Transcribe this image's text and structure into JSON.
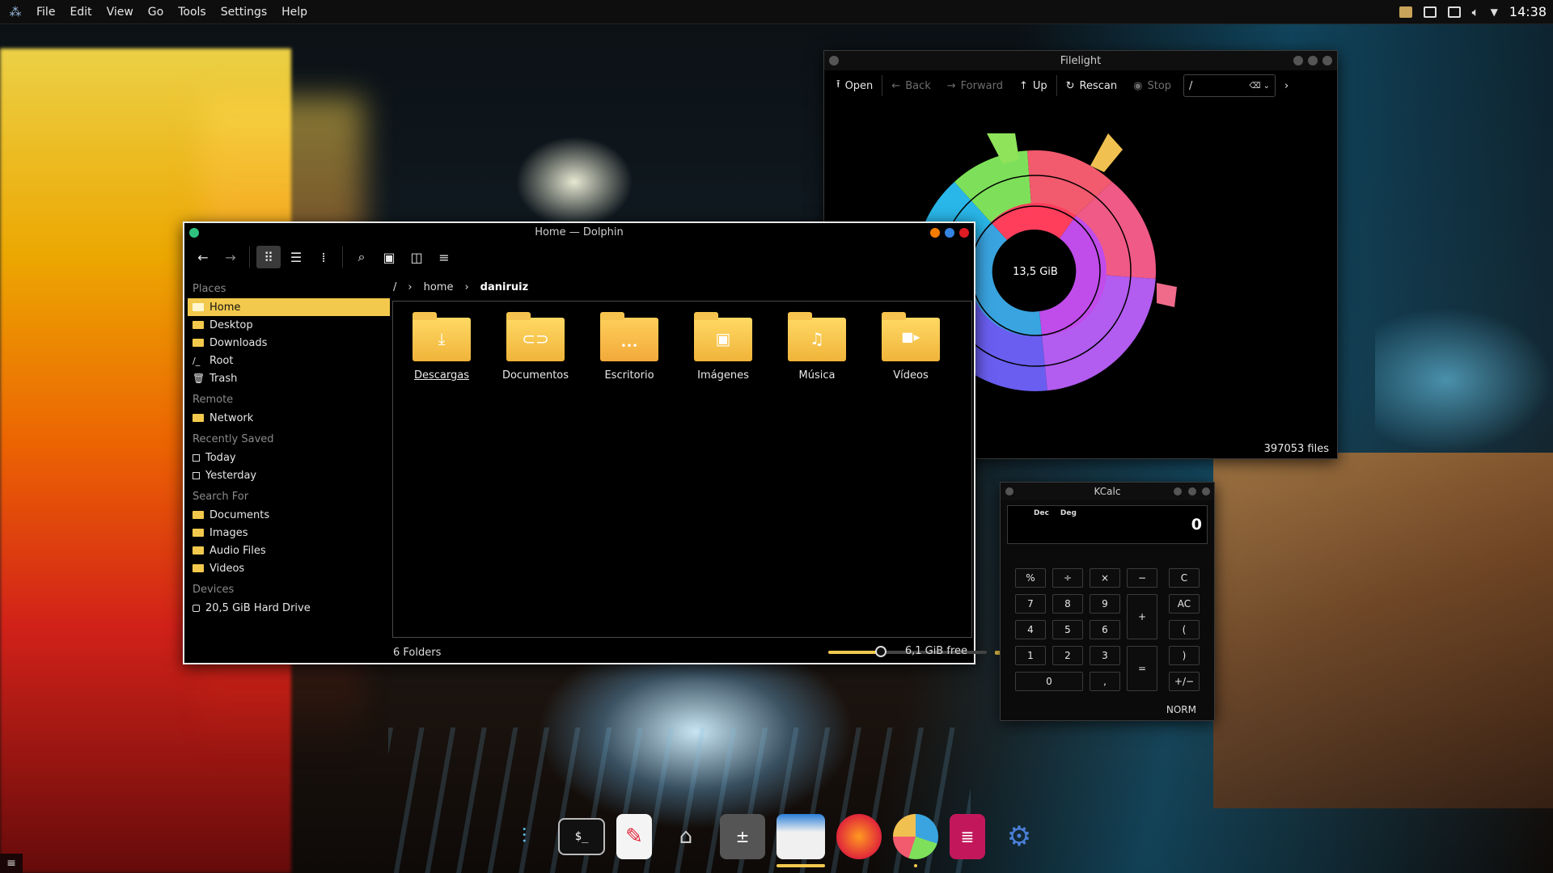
{
  "panel": {
    "menu": [
      "File",
      "Edit",
      "View",
      "Go",
      "Tools",
      "Settings",
      "Help"
    ],
    "clock": "14:38",
    "tray_icons": [
      "clipboard-icon",
      "display-icon",
      "notes-icon",
      "volume-icon",
      "arrow-down-icon"
    ]
  },
  "dolphin": {
    "title": "Home — Dolphin",
    "places": {
      "heading_places": "Places",
      "places_items": [
        "Home",
        "Desktop",
        "Downloads",
        "Root",
        "Trash"
      ],
      "heading_remote": "Remote",
      "remote_items": [
        "Network"
      ],
      "heading_recent": "Recently Saved",
      "recent_items": [
        "Today",
        "Yesterday"
      ],
      "heading_search": "Search For",
      "search_items": [
        "Documents",
        "Images",
        "Audio Files",
        "Videos"
      ],
      "heading_devices": "Devices",
      "devices_items": [
        "20,5 GiB Hard Drive"
      ]
    },
    "breadcrumb": {
      "root": "/",
      "home": "home",
      "current": "daniruiz"
    },
    "folders": [
      {
        "name": "Descargas",
        "glyph": "⤓"
      },
      {
        "name": "Documentos",
        "glyph": "⊂⊃"
      },
      {
        "name": "Escritorio",
        "glyph": "•••"
      },
      {
        "name": "Imágenes",
        "glyph": "▣"
      },
      {
        "name": "Música",
        "glyph": "♫"
      },
      {
        "name": "Vídeos",
        "glyph": "■▸"
      }
    ],
    "status": {
      "count": "6 Folders",
      "free": "6,1 GiB free",
      "zoom_fraction": 0.33,
      "used_fraction": 0.7
    },
    "accent": "#f2c94c"
  },
  "filelight": {
    "title": "Filelight",
    "toolbar": {
      "open": "Open",
      "back": "Back",
      "forward": "Forward",
      "up": "Up",
      "rescan": "Rescan",
      "stop": "Stop",
      "path": "/"
    },
    "center_label": "13,5 GiB",
    "files": "397053 files"
  },
  "kcalc": {
    "title": "KCalc",
    "mode1": "Dec",
    "mode2": "Deg",
    "display": "0",
    "norm": "NORM",
    "buttons": {
      "pct": "%",
      "div": "÷",
      "mul": "×",
      "minus": "−",
      "c": "C",
      "n7": "7",
      "n8": "8",
      "n9": "9",
      "plus": "+",
      "ac": "AC",
      "n4": "4",
      "n5": "5",
      "n6": "6",
      "lpar": "(",
      "n1": "1",
      "n2": "2",
      "n3": "3",
      "eq": "=",
      "rpar": ")",
      "n0": "0",
      "comma": ",",
      "pm": "+/−"
    }
  },
  "dock": [
    "mixer-icon",
    "terminal-icon",
    "text-editor-icon",
    "terminal-app-icon",
    "calculator-icon",
    "file-manager-icon",
    "firefox-icon",
    "filelight-icon",
    "document-viewer-icon",
    "settings-icon"
  ]
}
